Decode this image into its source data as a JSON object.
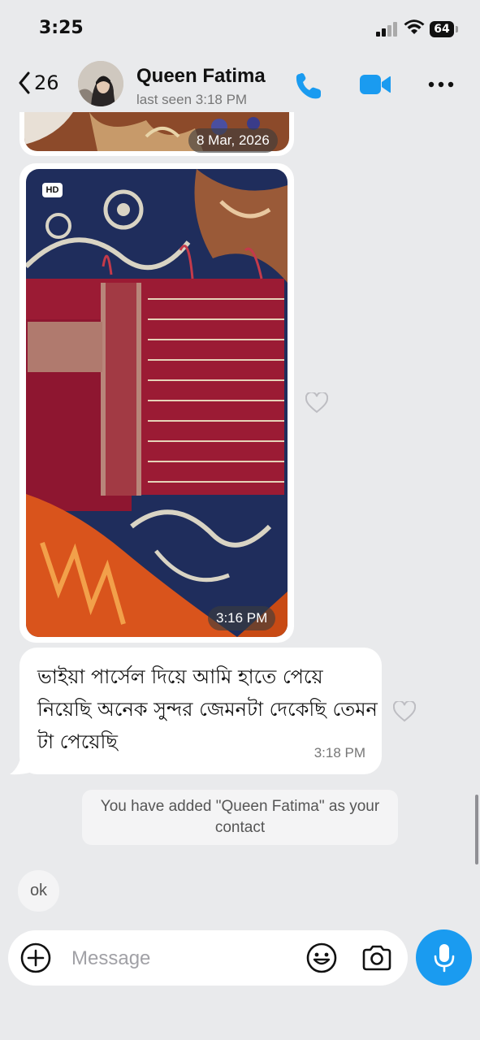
{
  "status_bar": {
    "time": "3:25",
    "battery": "64"
  },
  "header": {
    "back_count": "26",
    "contact_name": "Queen Fatima",
    "last_seen": "last seen 3:18 PM"
  },
  "messages": {
    "first_image_date": "8 Mar, 2026",
    "second_image": {
      "badge": "HD",
      "time": "3:16 PM"
    },
    "text_message": {
      "text": "ভাইয়া পার্সেল দিয়ে আমি হাতে পেয়ে নিয়েছি অনেক সুন্দর জেমনটা দেকেছি তেমন টা পেয়েছি",
      "time": "3:18 PM"
    },
    "system_message": "You have added \"Queen Fatima\" as your contact",
    "ok_message": "ok"
  },
  "composer": {
    "placeholder": "Message"
  },
  "icons": {
    "back": "chevron-left-icon",
    "call": "phone-icon",
    "video": "video-camera-icon",
    "more": "more-dots-icon",
    "react": "heart-icon",
    "attach": "plus-icon",
    "sticker": "sticker-icon",
    "camera": "camera-icon",
    "mic": "microphone-icon"
  },
  "colors": {
    "accent": "#1a9bf0",
    "background": "#e9eaec",
    "bubble": "#ffffff"
  }
}
